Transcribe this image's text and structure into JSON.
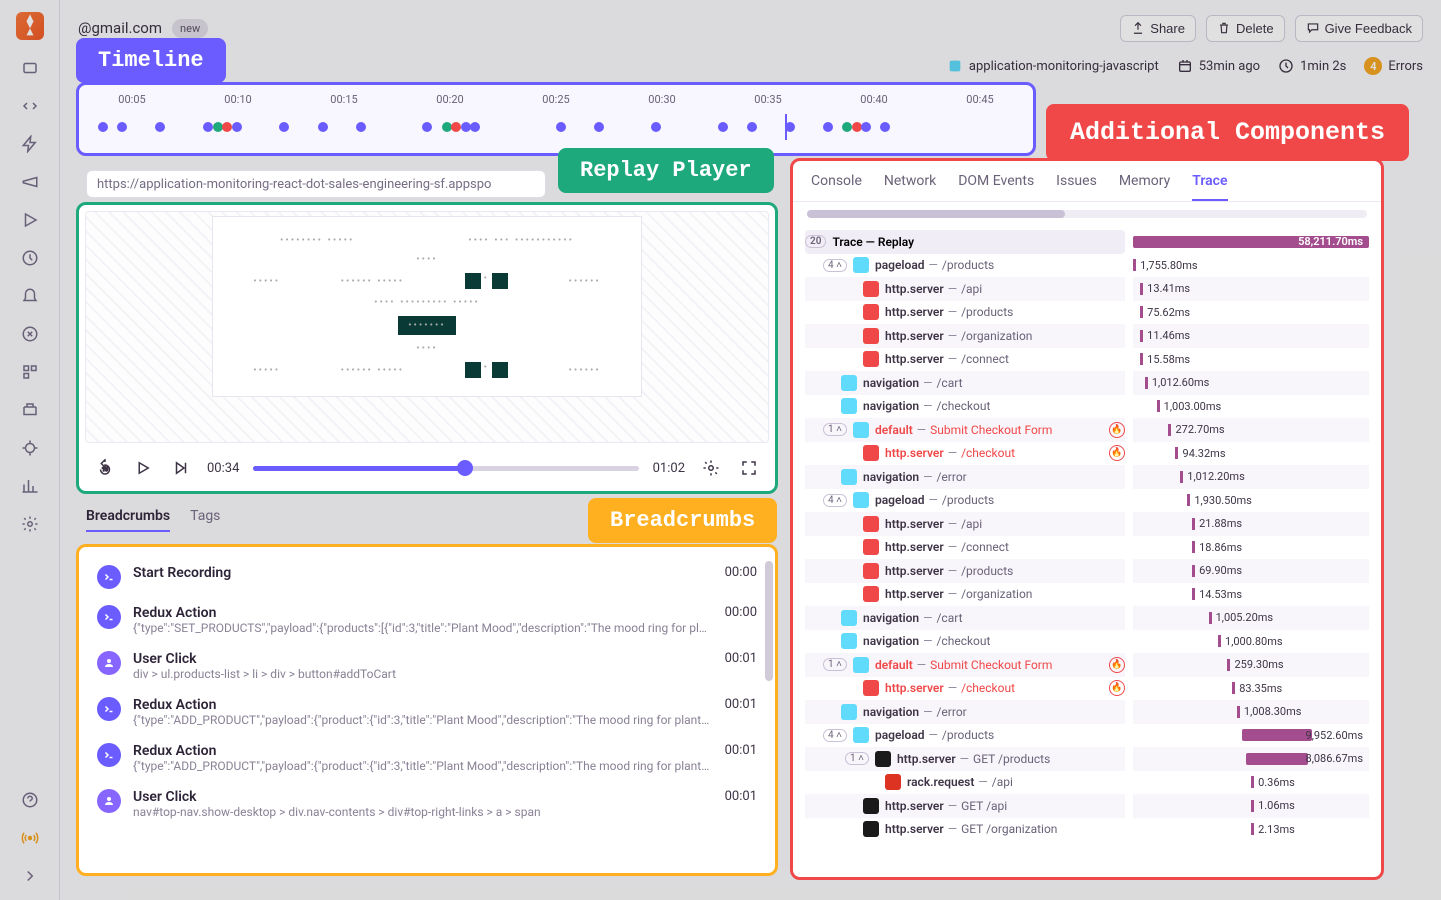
{
  "header": {
    "email": "@gmail.com",
    "chip": "new",
    "share": "Share",
    "delete": "Delete",
    "feedback": "Give Feedback",
    "project": "application-monitoring-javascript",
    "time_ago": "53min ago",
    "duration": "1min 2s",
    "errors_count": "4",
    "errors_label": "Errors"
  },
  "annotations": {
    "timeline": "Timeline",
    "replay": "Replay Player",
    "additional": "Additional Components",
    "breadcrumbs": "Breadcrumbs"
  },
  "timeline": {
    "ticks": [
      "00:05",
      "00:10",
      "00:15",
      "00:20",
      "00:25",
      "00:30",
      "00:35",
      "00:40",
      "00:45"
    ]
  },
  "url": "https://application-monitoring-react-dot-sales-engineering-sf.appspo",
  "player": {
    "current": "00:34",
    "total": "01:02"
  },
  "mid_tabs": {
    "breadcrumbs": "Breadcrumbs",
    "tags": "Tags"
  },
  "crumbs": [
    {
      "icon": ">",
      "kind": "r",
      "title": "Start Recording",
      "desc": "",
      "time": "00:00"
    },
    {
      "icon": ">",
      "kind": "r",
      "title": "Redux Action",
      "desc": "{\"type\":\"SET_PRODUCTS\",\"payload\":{\"products\":[{\"id\":3,\"title\":\"Plant Mood\",\"description\":\"The mood ring for plants.\",\"descrip…",
      "time": "00:00"
    },
    {
      "icon": "u",
      "kind": "u",
      "title": "User Click",
      "desc": "div > ul.products-list > li > div > button#addToCart",
      "time": "00:01"
    },
    {
      "icon": ">",
      "kind": "r",
      "title": "Redux Action",
      "desc": "{\"type\":\"ADD_PRODUCT\",\"payload\":{\"product\":{\"id\":3,\"title\":\"Plant Mood\",\"description\":\"The mood ring for plants.\",\"descriptio…",
      "time": "00:01"
    },
    {
      "icon": ">",
      "kind": "r",
      "title": "Redux Action",
      "desc": "{\"type\":\"ADD_PRODUCT\",\"payload\":{\"product\":{\"id\":3,\"title\":\"Plant Mood\",\"description\":\"The mood ring for plants.\",\"descriptio…",
      "time": "00:01"
    },
    {
      "icon": "u",
      "kind": "u",
      "title": "User Click",
      "desc": "nav#top-nav.show-desktop > div.nav-contents > div#top-right-links > a > span",
      "time": "00:01"
    }
  ],
  "side": {
    "tabs": [
      "Console",
      "Network",
      "DOM Events",
      "Issues",
      "Memory",
      "Trace"
    ],
    "header_count": "20",
    "header_label": "Trace — Replay",
    "header_dur": "58,211.70ms",
    "rows": [
      {
        "indent": 18,
        "badge": "4",
        "ic": "react",
        "op": "pageload",
        "path": "/products",
        "dur": "1,755.80ms",
        "bar": [
          0,
          4
        ],
        "alt": false
      },
      {
        "indent": 58,
        "ic": "http",
        "op": "http.server",
        "path": "/api",
        "dur": "13.41ms",
        "bar": [
          3,
          1
        ],
        "alt": true
      },
      {
        "indent": 58,
        "ic": "http",
        "op": "http.server",
        "path": "/products",
        "dur": "75.62ms",
        "bar": [
          3,
          1
        ],
        "alt": false
      },
      {
        "indent": 58,
        "ic": "http",
        "op": "http.server",
        "path": "/organization",
        "dur": "11.46ms",
        "bar": [
          3,
          1
        ],
        "alt": true
      },
      {
        "indent": 58,
        "ic": "http",
        "op": "http.server",
        "path": "/connect",
        "dur": "15.58ms",
        "bar": [
          3,
          1
        ],
        "alt": false
      },
      {
        "indent": 36,
        "ic": "react",
        "op": "navigation",
        "path": "/cart",
        "dur": "1,012.60ms",
        "bar": [
          5,
          2
        ],
        "alt": true
      },
      {
        "indent": 36,
        "ic": "react",
        "op": "navigation",
        "path": "/checkout",
        "dur": "1,003.00ms",
        "bar": [
          10,
          2
        ],
        "alt": false
      },
      {
        "indent": 18,
        "badge": "1",
        "ic": "react",
        "op": "default",
        "path": "Submit Checkout Form",
        "dur": "272.70ms",
        "bar": [
          15,
          2
        ],
        "alt": true,
        "red": true,
        "fire": true
      },
      {
        "indent": 58,
        "ic": "http",
        "op": "http.server",
        "path": "/checkout",
        "dur": "94.32ms",
        "bar": [
          18,
          1
        ],
        "alt": false,
        "red": true,
        "fire": true
      },
      {
        "indent": 36,
        "ic": "react",
        "op": "navigation",
        "path": "/error",
        "dur": "1,012.20ms",
        "bar": [
          20,
          2
        ],
        "alt": true
      },
      {
        "indent": 18,
        "badge": "4",
        "ic": "react",
        "op": "pageload",
        "path": "/products",
        "dur": "1,930.50ms",
        "bar": [
          23,
          4
        ],
        "alt": false
      },
      {
        "indent": 58,
        "ic": "http",
        "op": "http.server",
        "path": "/api",
        "dur": "21.88ms",
        "bar": [
          25,
          1
        ],
        "alt": true
      },
      {
        "indent": 58,
        "ic": "http",
        "op": "http.server",
        "path": "/connect",
        "dur": "18.86ms",
        "bar": [
          25,
          1
        ],
        "alt": false
      },
      {
        "indent": 58,
        "ic": "http",
        "op": "http.server",
        "path": "/products",
        "dur": "69.90ms",
        "bar": [
          25,
          1
        ],
        "alt": true
      },
      {
        "indent": 58,
        "ic": "http",
        "op": "http.server",
        "path": "/organization",
        "dur": "14.53ms",
        "bar": [
          25,
          1
        ],
        "alt": false
      },
      {
        "indent": 36,
        "ic": "react",
        "op": "navigation",
        "path": "/cart",
        "dur": "1,005.20ms",
        "bar": [
          32,
          2
        ],
        "alt": true
      },
      {
        "indent": 36,
        "ic": "react",
        "op": "navigation",
        "path": "/checkout",
        "dur": "1,000.80ms",
        "bar": [
          36,
          2
        ],
        "alt": false
      },
      {
        "indent": 18,
        "badge": "1",
        "ic": "react",
        "op": "default",
        "path": "Submit Checkout Form",
        "dur": "259.30ms",
        "bar": [
          40,
          2
        ],
        "alt": true,
        "red": true,
        "fire": true
      },
      {
        "indent": 58,
        "ic": "http",
        "op": "http.server",
        "path": "/checkout",
        "dur": "83.35ms",
        "bar": [
          42,
          1
        ],
        "alt": false,
        "red": true,
        "fire": true
      },
      {
        "indent": 36,
        "ic": "react",
        "op": "navigation",
        "path": "/error",
        "dur": "1,008.30ms",
        "bar": [
          44,
          2
        ],
        "alt": true
      },
      {
        "indent": 18,
        "badge": "4",
        "ic": "react",
        "op": "pageload",
        "path": "/products",
        "dur": "9,952.60ms",
        "bar": [
          46,
          30
        ],
        "alt": false,
        "big": true
      },
      {
        "indent": 40,
        "badge": "1",
        "ic": "dj",
        "op": "http.server",
        "path": "GET /products",
        "dur": "8,086.67ms",
        "bar": [
          48,
          26
        ],
        "alt": true,
        "big": true
      },
      {
        "indent": 80,
        "ic": "ru",
        "op": "rack.request",
        "path": "/api",
        "dur": "0.36ms",
        "bar": [
          50,
          1
        ],
        "alt": false
      },
      {
        "indent": 58,
        "ic": "dj",
        "op": "http.server",
        "path": "GET /api",
        "dur": "1.06ms",
        "bar": [
          50,
          1
        ],
        "alt": true
      },
      {
        "indent": 58,
        "ic": "dj",
        "op": "http.server",
        "path": "GET /organization",
        "dur": "2.13ms",
        "bar": [
          50,
          1
        ],
        "alt": false
      }
    ]
  }
}
